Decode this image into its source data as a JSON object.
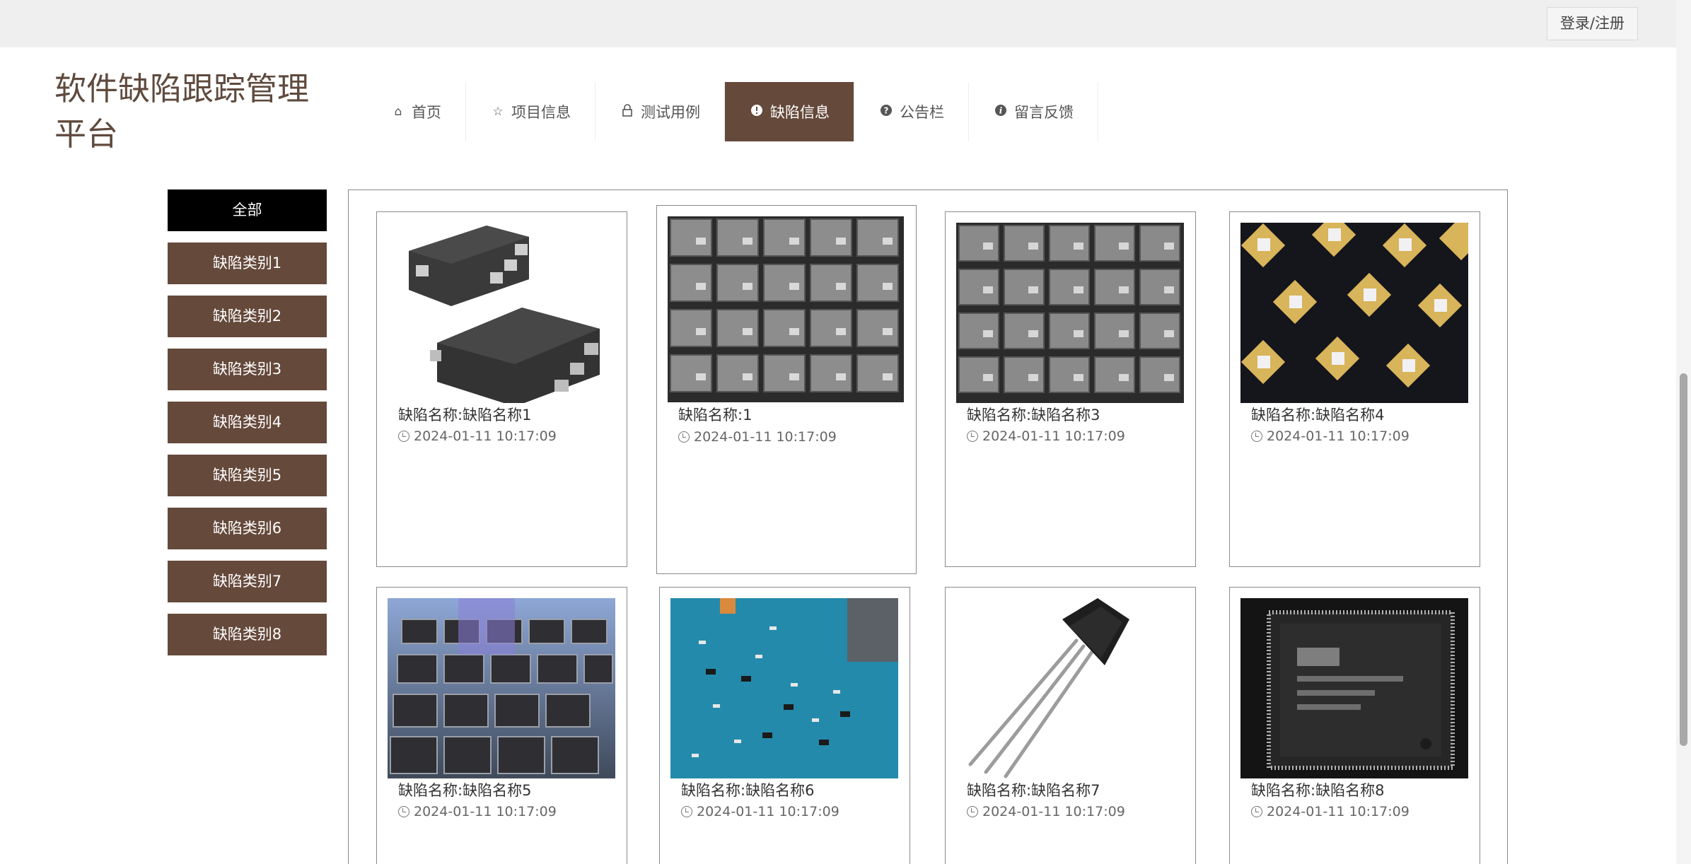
{
  "header": {
    "login_label": "登录/注册"
  },
  "site": {
    "title": "软件缺陷跟踪管理平台"
  },
  "nav": [
    {
      "label": "首页",
      "icon": "home-icon",
      "glyph": "⌂",
      "active": false
    },
    {
      "label": "项目信息",
      "icon": "star-icon",
      "glyph": "☆",
      "active": false
    },
    {
      "label": "测试用例",
      "icon": "lock-icon",
      "glyph": "⊓",
      "active": false
    },
    {
      "label": "缺陷信息",
      "icon": "exclamation-circle-icon",
      "glyph": "❗",
      "active": true
    },
    {
      "label": "公告栏",
      "icon": "question-circle-icon",
      "glyph": "❓",
      "active": false
    },
    {
      "label": "留言反馈",
      "icon": "info-circle-icon",
      "glyph": "ℹ",
      "active": false
    }
  ],
  "categories": [
    "全部",
    "缺陷类别1",
    "缺陷类别2",
    "缺陷类别3",
    "缺陷类别4",
    "缺陷类别5",
    "缺陷类别6",
    "缺陷类别7",
    "缺陷类别8"
  ],
  "cards": [
    {
      "name": "缺陷名称:缺陷名称1",
      "time": "2024-01-11 10:17:09",
      "image": "sot-chip"
    },
    {
      "name": "缺陷名称:1",
      "time": "2024-01-11 10:17:09",
      "image": "chip-tray"
    },
    {
      "name": "缺陷名称:缺陷名称3",
      "time": "2024-01-11 10:17:09",
      "image": "chip-tray"
    },
    {
      "name": "缺陷名称:缺陷名称4",
      "time": "2024-01-11 10:17:09",
      "image": "rf-transistors"
    },
    {
      "name": "缺陷名称:缺陷名称5",
      "time": "2024-01-11 10:17:09",
      "image": "qfp-tray"
    },
    {
      "name": "缺陷名称:缺陷名称6",
      "time": "2024-01-11 10:17:09",
      "image": "pcb-board"
    },
    {
      "name": "缺陷名称:缺陷名称7",
      "time": "2024-01-11 10:17:09",
      "image": "to92-transistor"
    },
    {
      "name": "缺陷名称:缺陷名称8",
      "time": "2024-01-11 10:17:09",
      "image": "qfp-chip"
    }
  ],
  "colors": {
    "accent": "#65493b",
    "active_category": "#000000",
    "title": "#5f4a3d"
  }
}
